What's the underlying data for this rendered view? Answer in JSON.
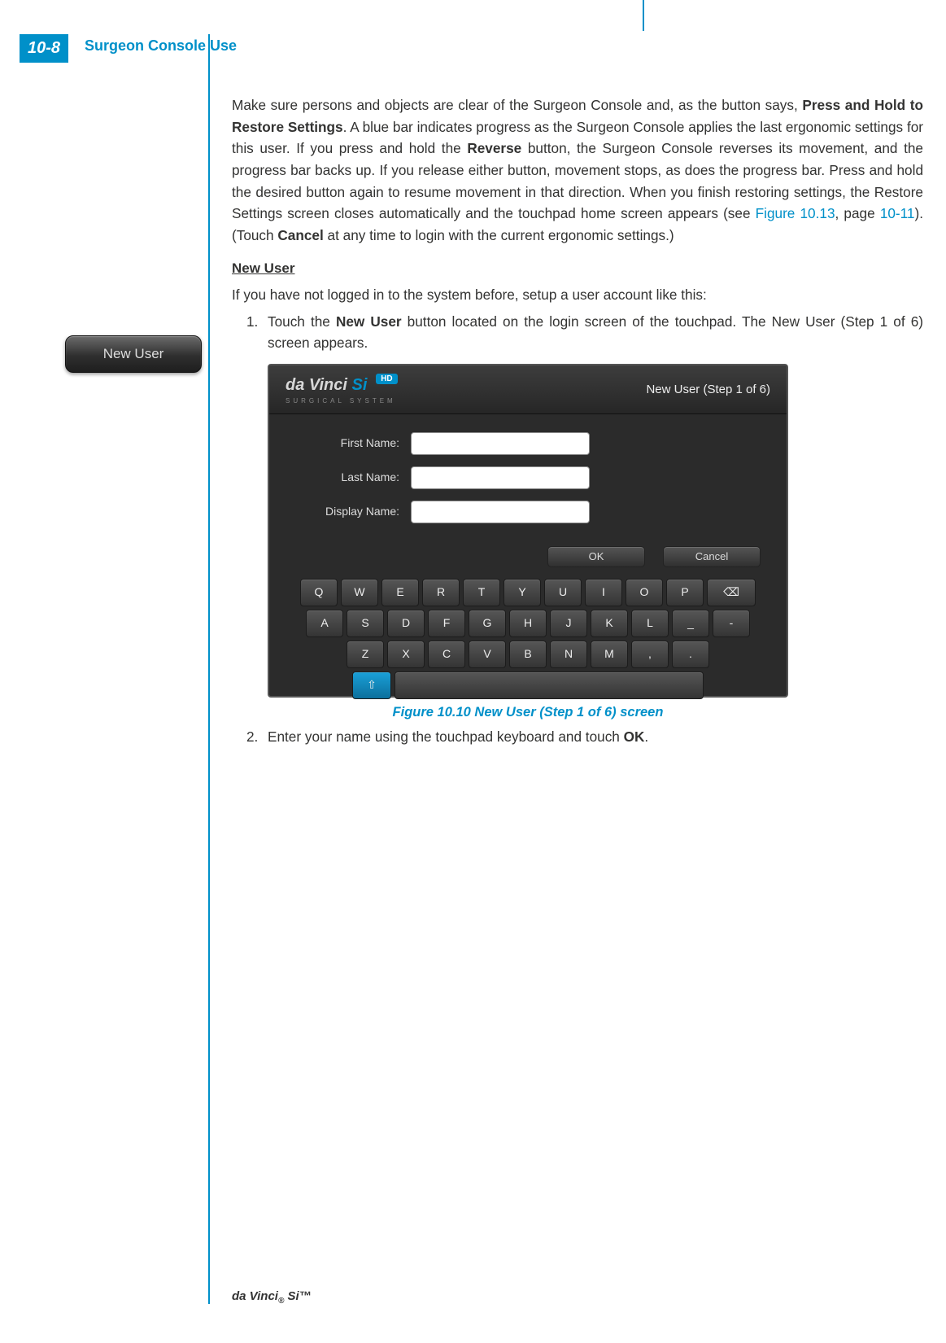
{
  "page": {
    "tab": "10-8",
    "section": "Surgeon Console Use",
    "footer_brand": "da Vinci",
    "footer_reg": "®",
    "footer_model": " Si™"
  },
  "para1": {
    "t1": "Make sure persons and objects are clear of the Surgeon Console and, as the button says, ",
    "b1": "Press and Hold to Restore Settings",
    "t2": ". A blue bar indicates progress as the Surgeon Console applies the last ergonomic settings for this user. If you press and hold the ",
    "b2": "Reverse",
    "t3": " button, the Surgeon Console reverses its movement, and the progress bar backs up. If you release either button, movement stops, as does the progress bar. Press and hold the desired button again to resume movement in that direction. When you finish restoring settings, the Restore Settings screen closes automatically and the touchpad home screen appears (see ",
    "link1": "Figure 10.13",
    "t4": ", page ",
    "link2": "10-11",
    "t5": "). (Touch ",
    "b3": "Cancel",
    "t6": " at any time to login with the current ergonomic settings.)"
  },
  "newuser": {
    "heading": "New User",
    "intro": "If you have not logged in to the system before, setup a user account like this:",
    "button_label": "New User",
    "step1_num": "1.",
    "step1_a": "Touch the ",
    "step1_b": "New User",
    "step1_c": " button located on the login screen of the touchpad. The New User (Step 1 of 6) screen appears.",
    "step2_num": "2.",
    "step2_a": "Enter your name using the touchpad keyboard and touch ",
    "step2_b": "OK",
    "step2_c": "."
  },
  "figure": {
    "caption": "Figure 10.10 New User (Step 1 of 6) screen",
    "logo_brand": "da Vinci",
    "logo_si": " Si",
    "logo_sub": "SURGICAL SYSTEM",
    "logo_hd": "HD",
    "header_right": "New User (Step 1 of 6)",
    "labels": {
      "first": "First Name:",
      "last": "Last Name:",
      "display": "Display Name:"
    },
    "buttons": {
      "ok": "OK",
      "cancel": "Cancel"
    },
    "kbd": {
      "r1": [
        "Q",
        "W",
        "E",
        "R",
        "T",
        "Y",
        "U",
        "I",
        "O",
        "P"
      ],
      "r2": [
        "A",
        "S",
        "D",
        "F",
        "G",
        "H",
        "J",
        "K",
        "L",
        "_",
        "-"
      ],
      "r3": [
        "Z",
        "X",
        "C",
        "V",
        "B",
        "N",
        "M",
        ",",
        "."
      ],
      "bksp": "⌫",
      "shift": "⇧"
    }
  }
}
